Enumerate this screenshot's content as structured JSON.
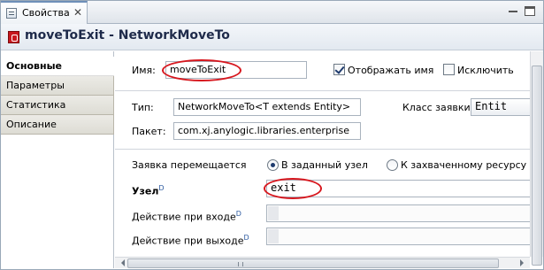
{
  "view_tab": {
    "title": "Свойства",
    "close": "✕"
  },
  "header": {
    "title": "moveToExit - NetworkMoveTo"
  },
  "nav": {
    "items": [
      {
        "label": "Основные",
        "active": true
      },
      {
        "label": "Параметры",
        "active": false
      },
      {
        "label": "Статистика",
        "active": false
      },
      {
        "label": "Описание",
        "active": false
      }
    ]
  },
  "general": {
    "name_label": "Имя:",
    "name_value": "moveToExit",
    "show_name_label": "Отображать имя",
    "show_name_checked": true,
    "exclude_label": "Исключить",
    "exclude_checked": false,
    "type_label": "Тип:",
    "type_value": "NetworkMoveTo<T extends Entity>",
    "request_class_label": "Класс заявки:",
    "request_class_value": "Entit",
    "package_label": "Пакет:",
    "package_value": "com.xj.anylogic.libraries.enterprise",
    "moves_label": "Заявка перемещается",
    "radio_node_label": "В заданный узел",
    "radio_node_selected": true,
    "radio_resource_label": "К захваченному ресурсу",
    "radio_resource_selected": false,
    "node_label": "Узел",
    "node_sup": "D",
    "node_value": "exit",
    "on_enter_label": "Действие при входе",
    "on_enter_sup": "D",
    "on_enter_value": "",
    "on_exit_label": "Действие при выходе",
    "on_exit_sup": "D",
    "on_exit_value": ""
  },
  "colors": {
    "highlight": "#d7171e",
    "header_text": "#1e2a4a"
  }
}
